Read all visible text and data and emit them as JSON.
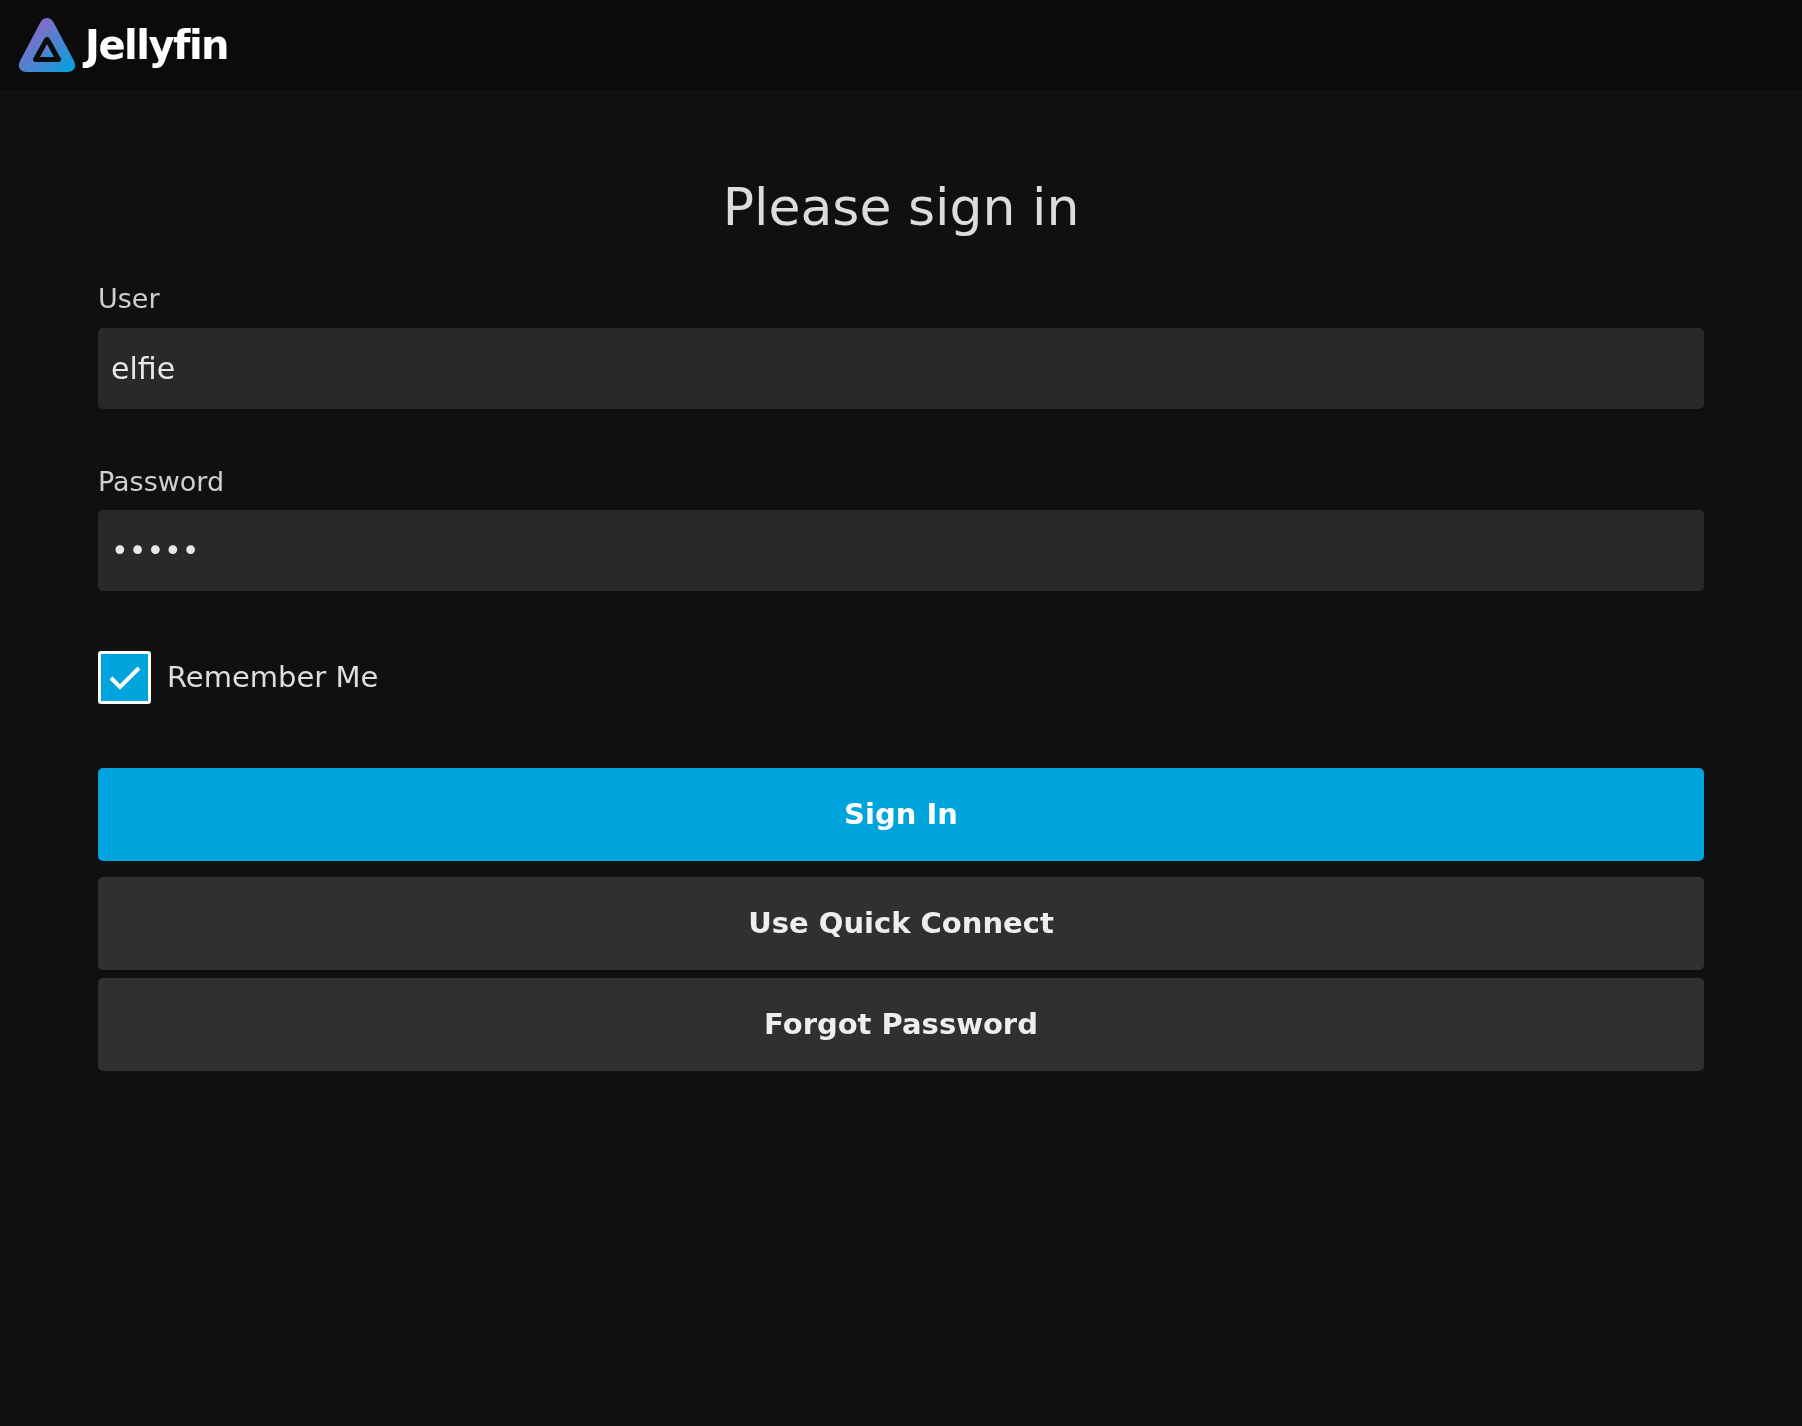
{
  "header": {
    "brand": "Jellyfin"
  },
  "title": "Please sign in",
  "fields": [
    {
      "label": "User",
      "value": "elfie"
    },
    {
      "label": "Password",
      "value": "•••••"
    }
  ],
  "remember": {
    "label": "Remember Me",
    "checked": true
  },
  "buttons": [
    {
      "label": "Sign In",
      "kind": "primary"
    },
    {
      "label": "Use Quick Connect",
      "kind": "secondary"
    },
    {
      "label": "Forgot Password",
      "kind": "secondary"
    }
  ]
}
